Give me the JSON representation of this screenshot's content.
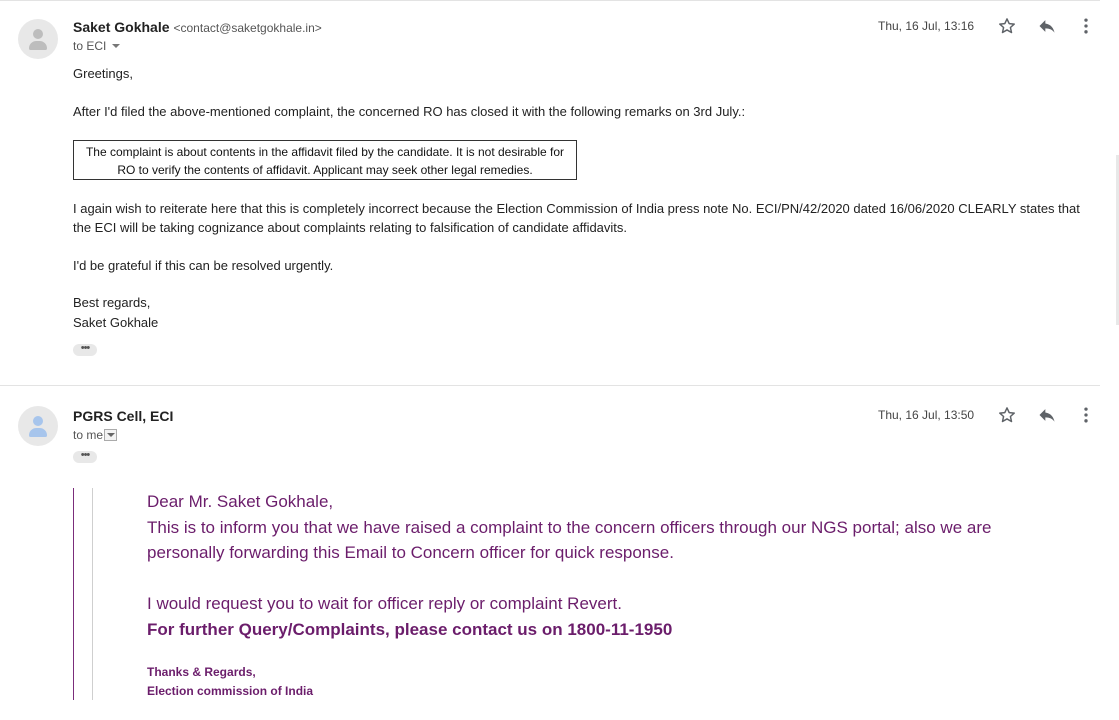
{
  "message1": {
    "sender_name": "Saket Gokhale",
    "sender_email": "<contact@saketgokhale.in>",
    "to_label": "to ECI",
    "date": "Thu, 16 Jul, 13:16",
    "greeting": "Greetings,",
    "para1": "After I'd filed the above-mentioned complaint, the concerned RO has closed it with the following remarks on 3rd July.:",
    "quote_line1": "The complaint is about contents in the affidavit filed by the candidate. It is not desirable for",
    "quote_line2": "RO to verify the contents of affidavit. Applicant may seek other legal remedies.",
    "para2_line1": "I again wish to reiterate here that this is completely incorrect because the Election Commission of India press note No. ECI/PN/42/2020 dated 16/06/2020 CLEARLY states that",
    "para2_line2": "the ECI will be taking cognizance about complaints relating to falsification of candidate affidavits.",
    "para3": "I'd be grateful if this can be resolved urgently.",
    "signoff": "Best regards,",
    "signature": "Saket Gokhale",
    "dots": "•••"
  },
  "message2": {
    "sender_name": "PGRS Cell, ECI",
    "to_label": "to me",
    "date": "Thu, 16 Jul, 13:50",
    "dots": "•••",
    "salutation": "Dear Mr. Saket Gokhale,",
    "line1": "This is to inform you that we have  raised a complaint to the concern officers through our NGS portal; also we are",
    "line2": "personally forwarding this Email to Concern officer for quick response.",
    "line3": "I would request you to wait for officer reply or complaint Revert.",
    "line4": "For further Query/Complaints, please contact us on 1800-11-1950",
    "thanks": "Thanks & Regards,",
    "org": "Election commission of India"
  },
  "icons": [
    "avatar-icon",
    "star-icon",
    "reply-icon",
    "more-vert-icon"
  ],
  "colors": {
    "reply_text": "#6b1d6b",
    "quote_bar": "#7b2d7b"
  }
}
